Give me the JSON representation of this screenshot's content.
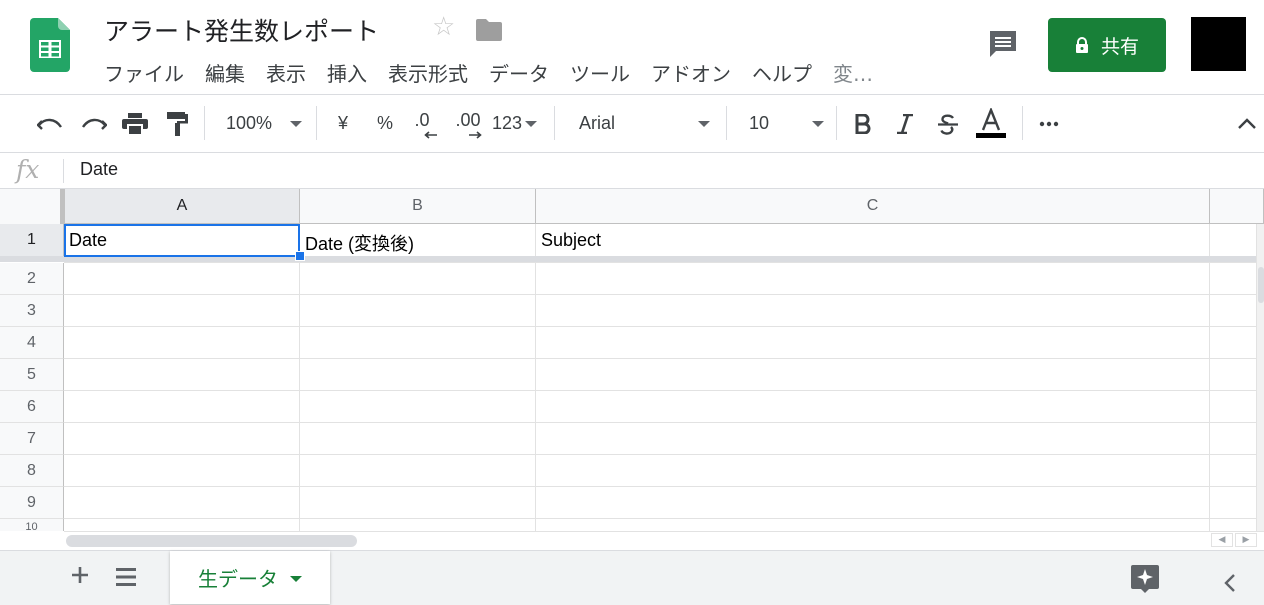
{
  "doc": {
    "title": "アラート発生数レポート"
  },
  "menu": [
    "ファイル",
    "編集",
    "表示",
    "挿入",
    "表示形式",
    "データ",
    "ツール",
    "アドオン",
    "ヘルプ",
    "変…"
  ],
  "share": {
    "label": "共有"
  },
  "toolbar": {
    "zoom": "100%",
    "currency": "¥",
    "percent": "%",
    "decimal_decrease": ".0",
    "decimal_increase": ".00",
    "more_formats": "123",
    "font": "Arial",
    "font_size": "10",
    "text_color": "#000000"
  },
  "formula": {
    "fx": "fx",
    "value": "Date"
  },
  "columns": [
    "A",
    "B",
    "C"
  ],
  "rows": [
    "1",
    "2",
    "3",
    "4",
    "5",
    "6",
    "7",
    "8",
    "9",
    "10"
  ],
  "cells": {
    "A1": "Date",
    "B1": "Date (変換後)",
    "C1": "Subject"
  },
  "sheets": [
    {
      "name": "生データ",
      "active": true
    }
  ],
  "colors": {
    "accent": "#188038",
    "selection": "#1a73e8"
  }
}
